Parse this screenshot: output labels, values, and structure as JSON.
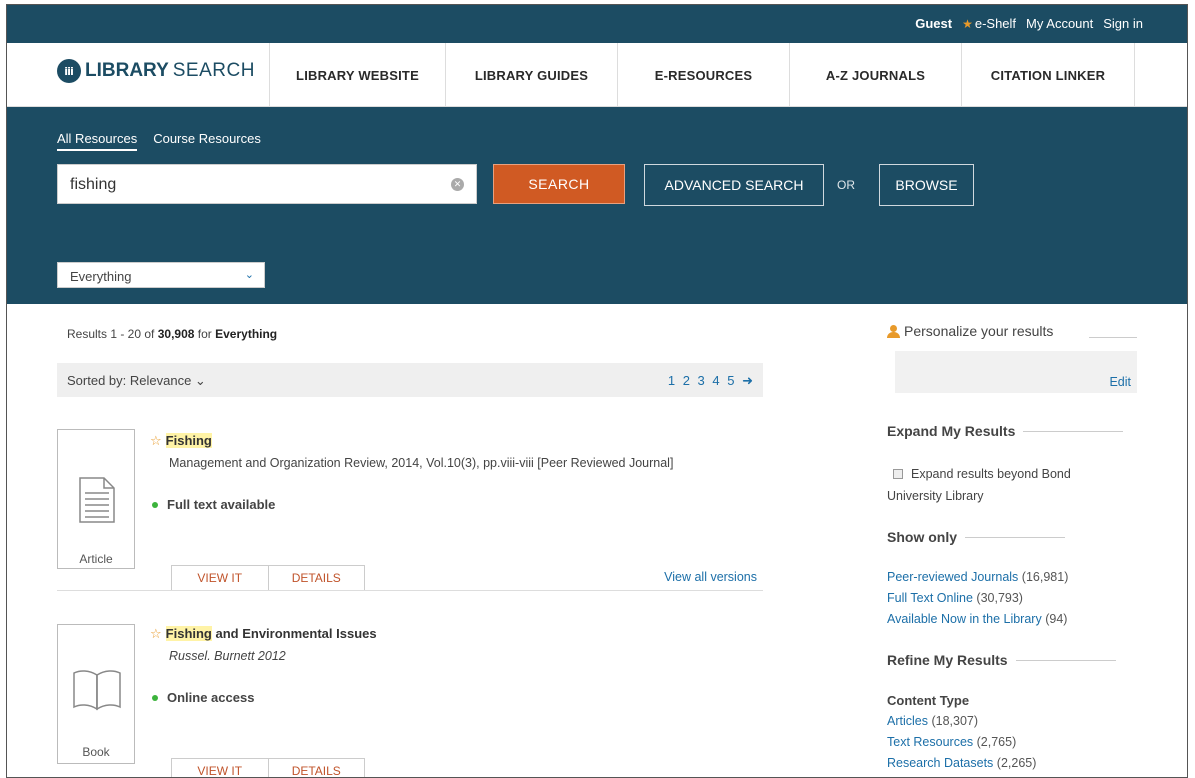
{
  "topbar": {
    "guest": "Guest",
    "eshelf": "e-Shelf",
    "account": "My Account",
    "signin": "Sign in"
  },
  "brand": {
    "logo_bold": "LIBRARY",
    "logo_light": "SEARCH"
  },
  "nav": [
    "LIBRARY WEBSITE",
    "LIBRARY GUIDES",
    "E-RESOURCES",
    "A-Z JOURNALS",
    "CITATION LINKER"
  ],
  "tabs": {
    "all": "All Resources",
    "course": "Course Resources"
  },
  "search": {
    "query": "fishing",
    "button": "SEARCH",
    "advanced": "ADVANCED SEARCH",
    "or": "OR",
    "browse": "BROWSE",
    "scope": "Everything"
  },
  "results": {
    "prefix": "Results 1 - 20 of",
    "total": "30,908",
    "for": "for",
    "scope": "Everything",
    "sort_label": "Sorted by: Relevance",
    "pages": "1 2 3 4 5",
    "items": [
      {
        "title_hl": "Fishing",
        "title_rest": "",
        "meta": "Management and Organization Review, 2014, Vol.10(3), pp.viii-viii [Peer Reviewed Journal]",
        "availability": "Full text available",
        "type": "Article",
        "view": "VIEW IT",
        "details": "DETAILS",
        "versions": "View all versions"
      },
      {
        "title_hl": "Fishing",
        "title_rest": " and Environmental Issues",
        "meta": "Russel. Burnett 2012",
        "availability": "Online access",
        "type": "Book",
        "view": "VIEW IT",
        "details": "DETAILS",
        "versions": ""
      }
    ]
  },
  "sidebar": {
    "personalize": "Personalize your results",
    "edit": "Edit",
    "expand_heading": "Expand My Results",
    "expand_option": "Expand results beyond Bond University Library",
    "show_only": "Show only",
    "show_items": [
      {
        "label": "Peer-reviewed Journals",
        "count": "(16,981)"
      },
      {
        "label": "Full Text Online",
        "count": "(30,793)"
      },
      {
        "label": "Available Now in the Library",
        "count": "(94)"
      }
    ],
    "refine": "Refine My Results",
    "content_type": "Content Type",
    "content_items": [
      {
        "label": "Articles",
        "count": "(18,307)"
      },
      {
        "label": "Text Resources",
        "count": "(2,765)"
      },
      {
        "label": "Research Datasets",
        "count": "(2,265)"
      }
    ]
  },
  "colors": {
    "brand_blue": "#1c4c63",
    "search_orange": "#d05a23",
    "link_blue": "#1c6fa8",
    "star": "#e89a2a",
    "available_green": "#3cb33c"
  }
}
